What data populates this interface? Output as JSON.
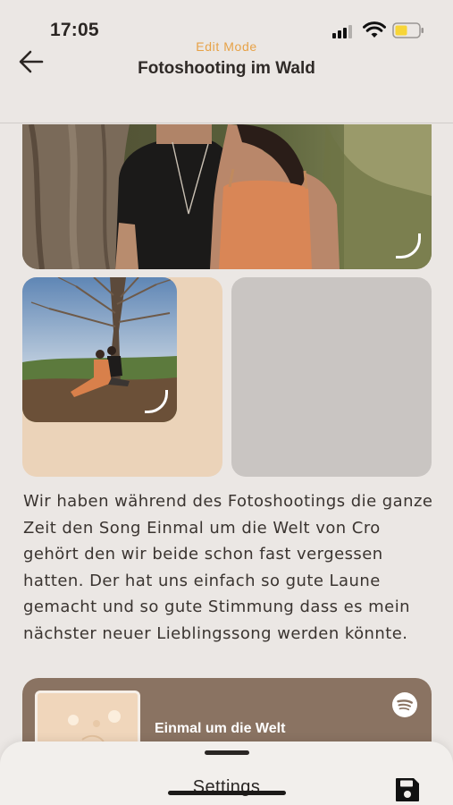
{
  "status_bar": {
    "time": "17:05",
    "signal_icon": "cellular-signal-icon",
    "wifi_icon": "wifi-icon",
    "battery_icon": "battery-icon",
    "battery_color": "#f7d538"
  },
  "header": {
    "mode_label": "Edit Mode",
    "title": "Fotoshooting im Wald",
    "back_icon": "arrow-left-icon",
    "accent_color": "#e7a247"
  },
  "content": {
    "story_text": "Wir haben während des Fotoshootings die ganze Zeit den Song Einmal um die Welt von Cro gehört den wir beide schon fast vergessen hatten. Der hat uns einfach so gute Laune gemacht und so gute Stimmung dass es mein nächster neuer Lieblingssong werden könnte.",
    "music_card": {
      "song_title": "Einmal um die Welt",
      "service_icon": "spotify-icon",
      "background_color": "#8a7362"
    },
    "card_colors": {
      "beige": "#ebd3b9",
      "gray": "#c9c5c2"
    }
  },
  "bottom_sheet": {
    "label": "Settings",
    "save_icon": "save-icon"
  }
}
